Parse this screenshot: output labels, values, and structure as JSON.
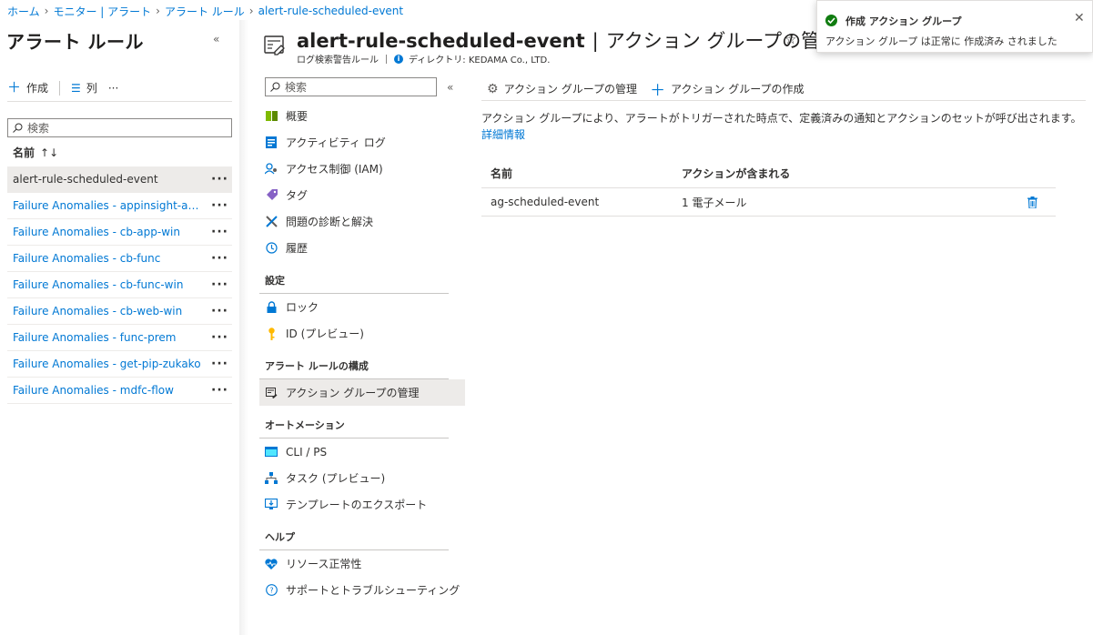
{
  "breadcrumb": [
    "ホーム",
    "モニター | アラート",
    "アラート ルール",
    "alert-rule-scheduled-event"
  ],
  "left_blade": {
    "title": "アラート ルール",
    "collapse": "«",
    "toolbar": {
      "create_label": "作成",
      "columns_label": "列",
      "more_label": "···"
    },
    "search_placeholder": "検索",
    "sort_header": "名前",
    "items": [
      {
        "name": "alert-rule-scheduled-event",
        "selected": true
      },
      {
        "name": "Failure Anomalies - appinsight-app···"
      },
      {
        "name": "Failure Anomalies - cb-app-win"
      },
      {
        "name": "Failure Anomalies - cb-func"
      },
      {
        "name": "Failure Anomalies - cb-func-win"
      },
      {
        "name": "Failure Anomalies - cb-web-win"
      },
      {
        "name": "Failure Anomalies - func-prem"
      },
      {
        "name": "Failure Anomalies - get-pip-zukako"
      },
      {
        "name": "Failure Anomalies - mdfc-flow"
      }
    ],
    "row_more": "···"
  },
  "blade": {
    "title_main": "alert-rule-scheduled-event",
    "title_sep": "|",
    "title_sub": "アクション グループの管理",
    "resource_type": "ログ検索警告ルール",
    "directory": "ディレクトリ: KEDAMA Co., LTD."
  },
  "menu": {
    "search_placeholder": "検索",
    "collapse": "«",
    "items_top": [
      {
        "label": "概要",
        "icon": "overview-icon"
      },
      {
        "label": "アクティビティ ログ",
        "icon": "activity-log-icon"
      },
      {
        "label": "アクセス制御 (IAM)",
        "icon": "iam-icon"
      },
      {
        "label": "タグ",
        "icon": "tag-icon"
      },
      {
        "label": "問題の診断と解決",
        "icon": "diagnose-icon"
      },
      {
        "label": "履歴",
        "icon": "history-icon"
      }
    ],
    "section_settings": "設定",
    "items_settings": [
      {
        "label": "ロック",
        "icon": "lock-icon"
      },
      {
        "label": "ID (プレビュー)",
        "icon": "key-icon"
      }
    ],
    "section_config": "アラート ルールの構成",
    "items_config": [
      {
        "label": "アクション グループの管理",
        "icon": "action-group-icon",
        "selected": true
      }
    ],
    "section_automation": "オートメーション",
    "items_automation": [
      {
        "label": "CLI / PS",
        "icon": "cli-icon"
      },
      {
        "label": "タスク (プレビュー)",
        "icon": "tasks-icon"
      },
      {
        "label": "テンプレートのエクスポート",
        "icon": "export-template-icon"
      }
    ],
    "section_help": "ヘルプ",
    "items_help": [
      {
        "label": "リソース正常性",
        "icon": "resource-health-icon"
      },
      {
        "label": "サポートとトラブルシューティング",
        "icon": "support-icon"
      }
    ]
  },
  "content": {
    "toolbar": {
      "manage_label": "アクション グループの管理",
      "create_label": "アクション グループの作成"
    },
    "description": "アクション グループにより、アラートがトリガーされた時点で、定義済みの通知とアクションのセットが呼び出されます。",
    "learn_more": "詳細情報",
    "table": {
      "headers": [
        "名前",
        "アクションが含まれる"
      ],
      "rows": [
        {
          "name": "ag-scheduled-event",
          "actions": "1 電子メール"
        }
      ]
    }
  },
  "toast": {
    "title": "作成 アクション グループ",
    "message": "アクション グループ は正常に 作成済み されました",
    "close": "✕"
  },
  "colors": {
    "accent": "#0078d4",
    "success": "#107c10",
    "selected_bg": "#edebe9"
  }
}
